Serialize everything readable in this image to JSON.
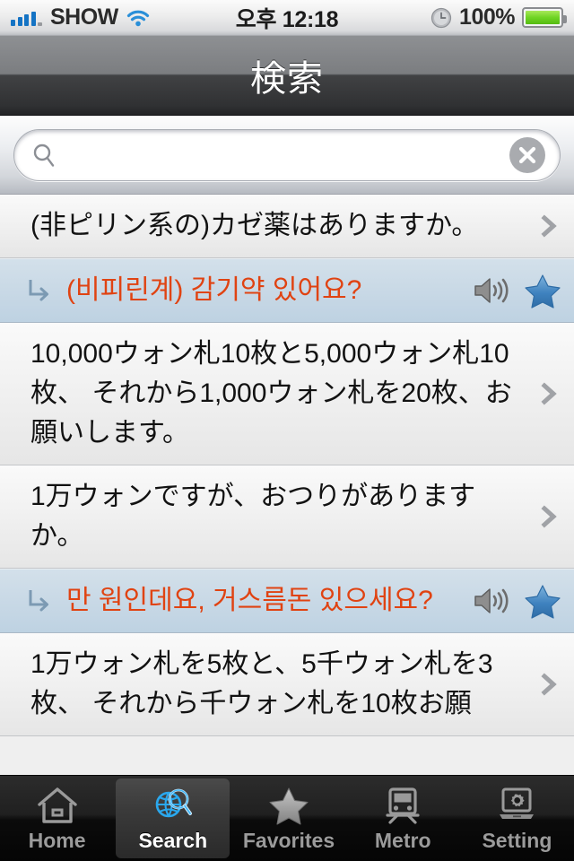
{
  "status_bar": {
    "carrier": "SHOW",
    "wifi_icon": "wifi-icon",
    "signal_icon": "signal-bars-icon",
    "time": "오후 12:18",
    "alarm_icon": "clock-icon",
    "battery_percent": "100%",
    "battery_icon": "battery-icon",
    "battery_color": "#6fd424",
    "signal_color": "#1473c4"
  },
  "nav_bar": {
    "title": "検索"
  },
  "search": {
    "value": "",
    "placeholder": "",
    "search_icon": "magnifier-icon",
    "clear_icon": "clear-circle-icon"
  },
  "list": {
    "rows": [
      {
        "lang": "jp",
        "text": "(非ピリン系の)カゼ薬はありますか。",
        "accessory": "chevron-icon"
      },
      {
        "lang": "kr",
        "text": "(비피린계) 감기약 있어요?",
        "sub_arrow_icon": "sub-arrow-icon",
        "speaker_icon": "speaker-icon",
        "star_icon": "star-icon"
      },
      {
        "lang": "jp",
        "text": "10,000ウォン札10枚と5,000ウォン札10枚、 それから1,000ウォン札を20枚、お願いします。",
        "accessory": "chevron-icon"
      },
      {
        "lang": "jp",
        "text": "1万ウォンですが、おつりがありますか。",
        "accessory": "chevron-icon"
      },
      {
        "lang": "kr",
        "text": "만 원인데요, 거스름돈 있으세요?",
        "sub_arrow_icon": "sub-arrow-icon",
        "speaker_icon": "speaker-icon",
        "star_icon": "star-icon"
      },
      {
        "lang": "jp",
        "text": "1万ウォン札を5枚と、5千ウォン札を3枚、 それから千ウォン札を10枚お願",
        "accessory": "chevron-icon"
      }
    ],
    "korean_text_color": "#e04312",
    "korean_row_bg": "#c9d9e6"
  },
  "tab_bar": {
    "active": "Search",
    "tabs": [
      {
        "label": "Home",
        "icon": "home-icon"
      },
      {
        "label": "Search",
        "icon": "globe-search-icon"
      },
      {
        "label": "Favorites",
        "icon": "star-icon"
      },
      {
        "label": "Metro",
        "icon": "train-icon"
      },
      {
        "label": "Setting",
        "icon": "laptop-gear-icon"
      }
    ]
  }
}
